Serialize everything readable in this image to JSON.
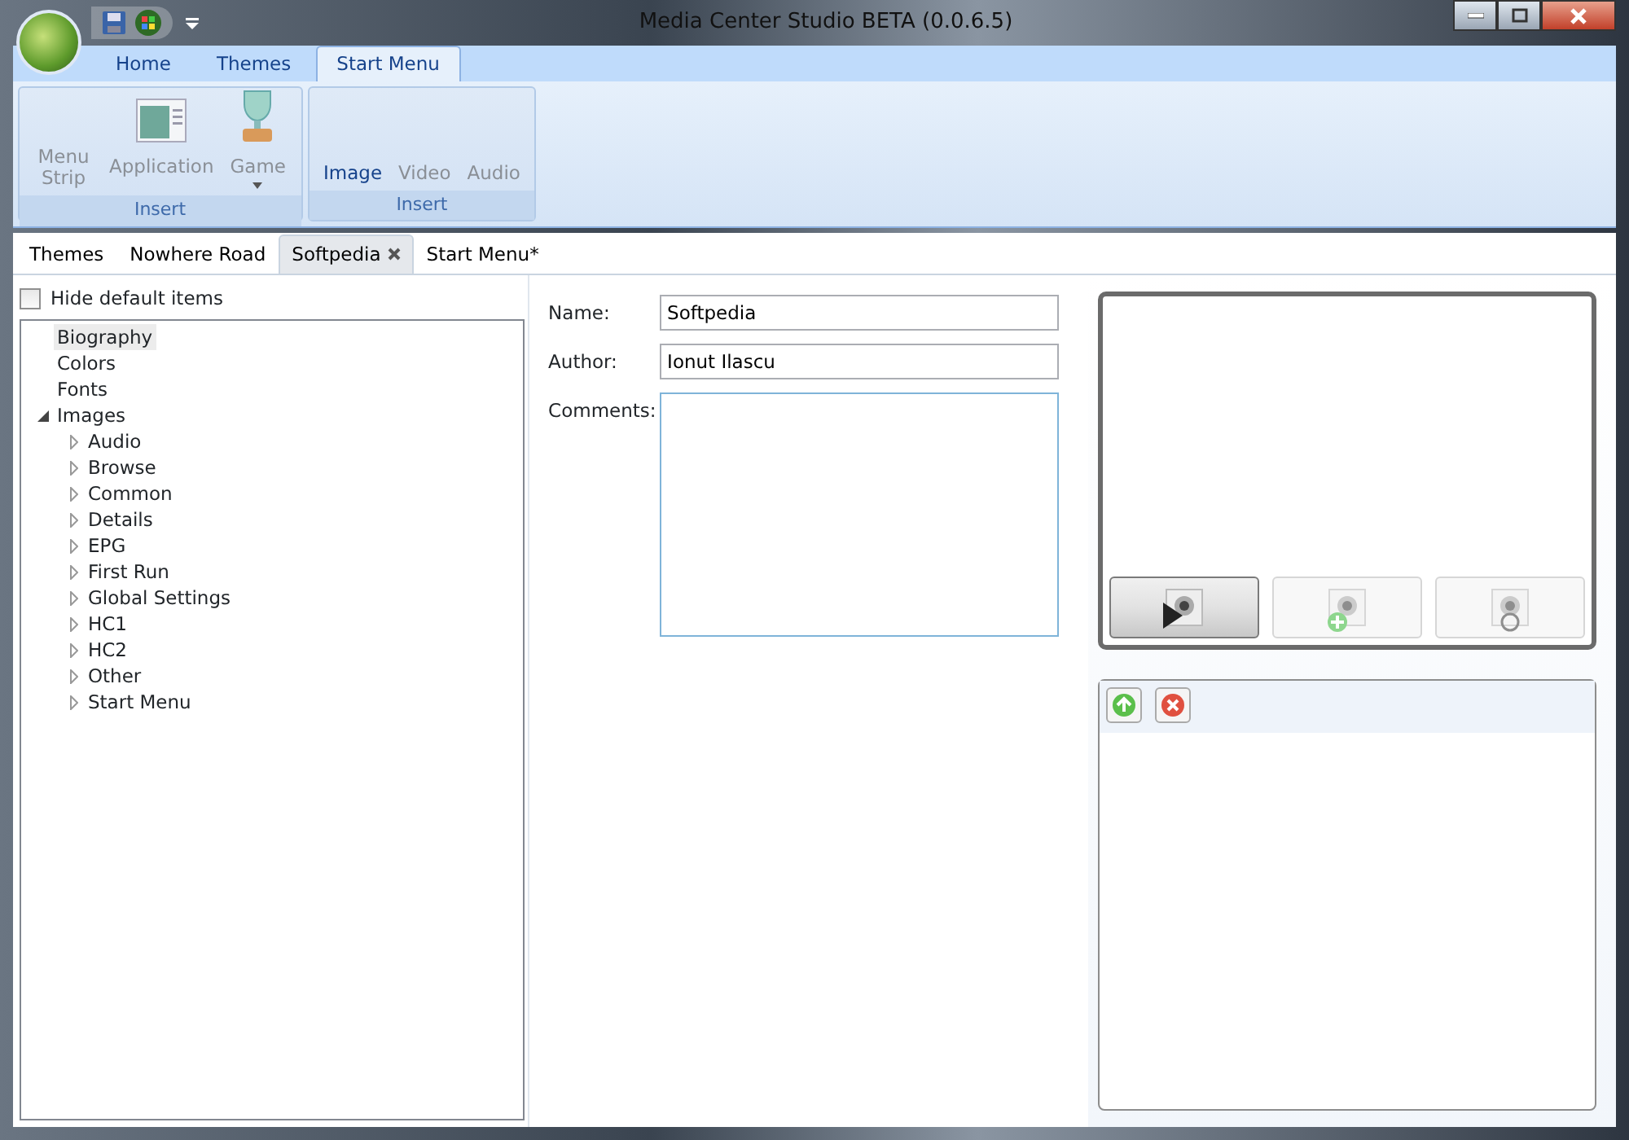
{
  "window": {
    "title": "Media Center Studio BETA (0.0.6.5)"
  },
  "ribbon": {
    "tabs": [
      {
        "label": "Home",
        "selected": false
      },
      {
        "label": "Themes",
        "selected": false
      },
      {
        "label": "Start Menu",
        "selected": true
      }
    ],
    "groups": [
      {
        "label": "Insert",
        "buttons": [
          {
            "label": "Menu Strip",
            "kind": "text",
            "disabled": true
          },
          {
            "label": "Application",
            "kind": "application",
            "disabled": true
          },
          {
            "label": "Game",
            "kind": "game",
            "disabled": true,
            "dropdown": true
          }
        ]
      },
      {
        "label": "Insert",
        "buttons": [
          {
            "label": "Image",
            "kind": "text",
            "disabled": false
          },
          {
            "label": "Video",
            "kind": "text",
            "disabled": true
          },
          {
            "label": "Audio",
            "kind": "text",
            "disabled": true
          }
        ]
      }
    ]
  },
  "document_tabs": [
    {
      "label": "Themes",
      "selected": false
    },
    {
      "label": "Nowhere Road",
      "selected": false
    },
    {
      "label": "Softpedia",
      "selected": true
    },
    {
      "label": "Start Menu*",
      "selected": false
    }
  ],
  "hide_default_items": {
    "label": "Hide default items",
    "checked": false
  },
  "tree": [
    {
      "label": "Biography",
      "selected": true
    },
    {
      "label": "Colors",
      "selected": false
    },
    {
      "label": "Fonts",
      "selected": false
    },
    {
      "label": "Images",
      "selected": false,
      "expanded": true,
      "children": [
        {
          "label": "Audio",
          "selected": false,
          "expanded": false
        },
        {
          "label": "Browse",
          "selected": false,
          "expanded": false
        },
        {
          "label": "Common",
          "selected": false,
          "expanded": false
        },
        {
          "label": "Details",
          "selected": false,
          "expanded": false
        },
        {
          "label": "EPG",
          "selected": false,
          "expanded": false
        },
        {
          "label": "First Run",
          "selected": false,
          "expanded": false
        },
        {
          "label": "Global Settings",
          "selected": false,
          "expanded": false
        },
        {
          "label": "HC1",
          "selected": false,
          "expanded": false
        },
        {
          "label": "HC2",
          "selected": false,
          "expanded": false
        },
        {
          "label": "Other",
          "selected": false,
          "expanded": false
        },
        {
          "label": "Start Menu",
          "selected": false,
          "expanded": false
        }
      ]
    }
  ],
  "form": {
    "name": {
      "label": "Name:",
      "value": "Softpedia"
    },
    "author": {
      "label": "Author:",
      "value": "Ionut Ilascu"
    },
    "comments": {
      "label": "Comments:"
    }
  },
  "preview_buttons": [
    {
      "kind": "play",
      "disabled": false
    },
    {
      "kind": "add",
      "disabled": true
    },
    {
      "kind": "refresh",
      "disabled": true
    }
  ],
  "list_tools": [
    {
      "kind": "up"
    },
    {
      "kind": "delete"
    }
  ]
}
